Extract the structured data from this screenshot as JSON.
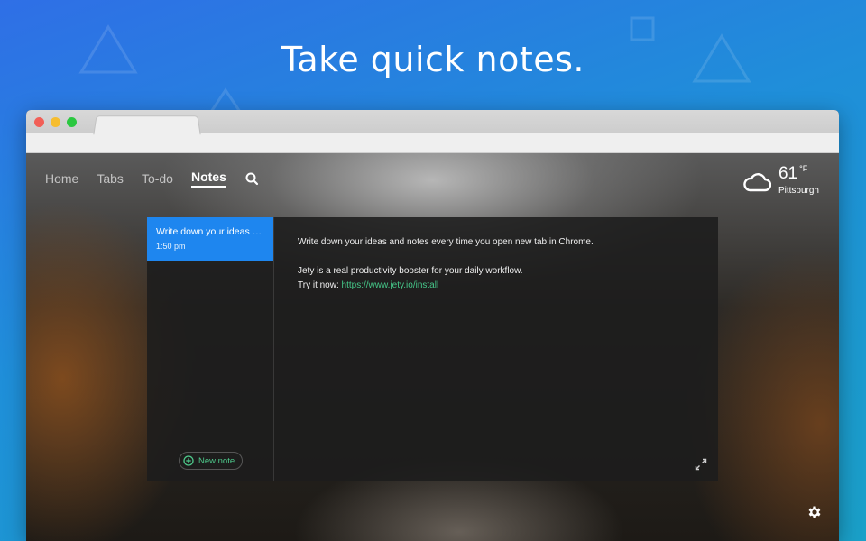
{
  "headline": "Take quick notes.",
  "nav": {
    "items": [
      {
        "label": "Home"
      },
      {
        "label": "Tabs"
      },
      {
        "label": "To-do"
      },
      {
        "label": "Notes"
      }
    ],
    "active": "Notes",
    "search_icon": "search-icon"
  },
  "weather": {
    "icon": "cloud-icon",
    "temperature": "61",
    "unit": "°F",
    "city": "Pittsburgh"
  },
  "notes": {
    "list": [
      {
        "title": "Write down your ideas and notes every time you open new tab in Chrome.",
        "time": "1:50 pm"
      }
    ],
    "new_note_label": "New note",
    "editor": {
      "line1": "Write down your ideas and notes every time you open new tab in Chrome.",
      "line2": "Jety is a real productivity booster for your daily workflow.",
      "line3_prefix": "Try it now: ",
      "link_text": "https://www.jety.io/install"
    },
    "expand_icon": "expand-icon"
  },
  "settings_icon": "gear-icon",
  "colors": {
    "background_start": "#2f6fe6",
    "background_end": "#1aa0c8",
    "accent_blue": "#1e86ef",
    "link_green": "#46c98a"
  }
}
